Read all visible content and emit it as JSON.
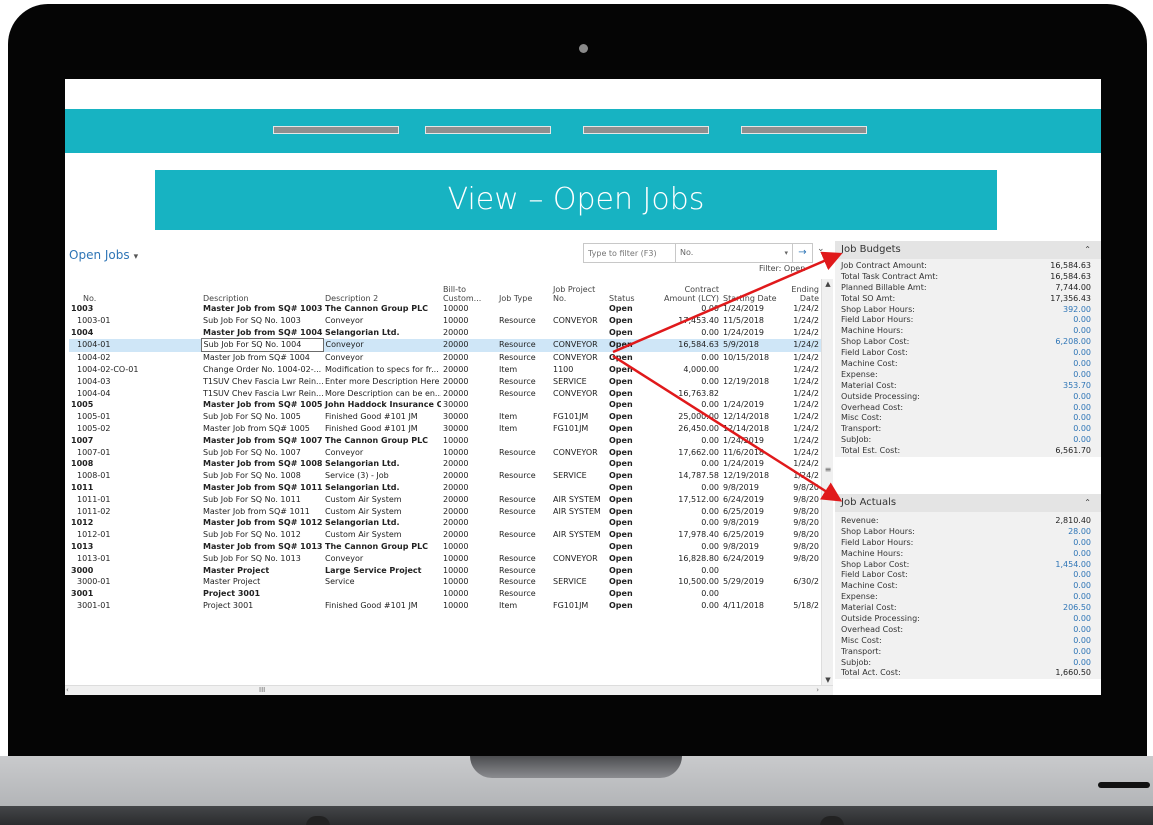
{
  "banner_title": "View – Open Jobs",
  "grid": {
    "title": "Open Jobs",
    "filter_placeholder": "Type to filter (F3)",
    "filter_field": "No.",
    "filter_label": "Filter: Open",
    "columns": [
      "No.",
      "Description",
      "Description 2",
      "Bill-to Custom...",
      "Job Type",
      "Job Project No.",
      "Status",
      "Contract Amount (LCY)",
      "Starting Date",
      "Ending Date"
    ],
    "rows": [
      {
        "no": "1003",
        "desc": "Master Job from SQ# 1003",
        "desc2": "The Cannon Group PLC",
        "bill": "10000",
        "type": "",
        "proj": "",
        "status": "Open",
        "amount": "0.00",
        "start": "1/24/2019",
        "end": "1/24/2",
        "master": true
      },
      {
        "no": "1003-01",
        "desc": "Sub Job For SQ No. 1003",
        "desc2": "Conveyor",
        "bill": "10000",
        "type": "Resource",
        "proj": "CONVEYOR",
        "status": "Open",
        "amount": "17,453.40",
        "start": "11/5/2018",
        "end": "1/24/2",
        "master": false
      },
      {
        "no": "1004",
        "desc": "Master Job from SQ# 1004",
        "desc2": "Selangorian Ltd.",
        "bill": "20000",
        "type": "",
        "proj": "",
        "status": "Open",
        "amount": "0.00",
        "start": "1/24/2019",
        "end": "1/24/2",
        "master": true
      },
      {
        "no": "1004-01",
        "desc": "Sub Job For SQ No. 1004",
        "desc2": "Conveyor",
        "bill": "20000",
        "type": "Resource",
        "proj": "CONVEYOR",
        "status": "Open",
        "amount": "16,584.63",
        "start": "5/9/2018",
        "end": "1/24/2",
        "master": false,
        "selected": true
      },
      {
        "no": "1004-02",
        "desc": "Master Job from SQ# 1004",
        "desc2": "Conveyor",
        "bill": "20000",
        "type": "Resource",
        "proj": "CONVEYOR",
        "status": "Open",
        "amount": "0.00",
        "start": "10/15/2018",
        "end": "1/24/2",
        "master": false
      },
      {
        "no": "1004-02-CO-01",
        "desc": "Change Order No. 1004-02-...",
        "desc2": "Modification to specs for fr...",
        "bill": "20000",
        "type": "Item",
        "proj": "1100",
        "status": "Open",
        "amount": "4,000.00",
        "start": "",
        "end": "1/24/2",
        "master": false
      },
      {
        "no": "1004-03",
        "desc": "T1SUV Chev Fascia Lwr Rein...",
        "desc2": "Enter more Description Here",
        "bill": "20000",
        "type": "Resource",
        "proj": "SERVICE",
        "status": "Open",
        "amount": "0.00",
        "start": "12/19/2018",
        "end": "1/24/2",
        "master": false
      },
      {
        "no": "1004-04",
        "desc": "T1SUV Chev Fascia Lwr Rein...",
        "desc2": "More Description can be en...",
        "bill": "20000",
        "type": "Resource",
        "proj": "CONVEYOR",
        "status": "Open",
        "amount": "16,763.82",
        "start": "",
        "end": "1/24/2",
        "master": false
      },
      {
        "no": "1005",
        "desc": "Master Job from SQ# 1005",
        "desc2": "John Haddock Insurance Co.",
        "bill": "30000",
        "type": "",
        "proj": "",
        "status": "Open",
        "amount": "0.00",
        "start": "1/24/2019",
        "end": "1/24/2",
        "master": true
      },
      {
        "no": "1005-01",
        "desc": "Sub Job For SQ No. 1005",
        "desc2": "Finished Good #101 JM",
        "bill": "30000",
        "type": "Item",
        "proj": "FG101JM",
        "status": "Open",
        "amount": "25,000.00",
        "start": "12/14/2018",
        "end": "1/24/2",
        "master": false
      },
      {
        "no": "1005-02",
        "desc": "Master Job from SQ# 1005",
        "desc2": "Finished Good #101 JM",
        "bill": "30000",
        "type": "Item",
        "proj": "FG101JM",
        "status": "Open",
        "amount": "26,450.00",
        "start": "12/14/2018",
        "end": "1/24/2",
        "master": false
      },
      {
        "no": "1007",
        "desc": "Master Job from SQ# 1007",
        "desc2": "The Cannon Group PLC",
        "bill": "10000",
        "type": "",
        "proj": "",
        "status": "Open",
        "amount": "0.00",
        "start": "1/24/2019",
        "end": "1/24/2",
        "master": true
      },
      {
        "no": "1007-01",
        "desc": "Sub Job For SQ No. 1007",
        "desc2": "Conveyor",
        "bill": "10000",
        "type": "Resource",
        "proj": "CONVEYOR",
        "status": "Open",
        "amount": "17,662.00",
        "start": "11/6/2018",
        "end": "1/24/2",
        "master": false
      },
      {
        "no": "1008",
        "desc": "Master Job from SQ# 1008",
        "desc2": "Selangorian Ltd.",
        "bill": "20000",
        "type": "",
        "proj": "",
        "status": "Open",
        "amount": "0.00",
        "start": "1/24/2019",
        "end": "1/24/2",
        "master": true
      },
      {
        "no": "1008-01",
        "desc": "Sub Job For SQ No. 1008",
        "desc2": "Service (3) - Job",
        "bill": "20000",
        "type": "Resource",
        "proj": "SERVICE",
        "status": "Open",
        "amount": "14,787.58",
        "start": "12/19/2018",
        "end": "1/24/2",
        "master": false
      },
      {
        "no": "1011",
        "desc": "Master Job from SQ# 1011",
        "desc2": "Selangorian Ltd.",
        "bill": "20000",
        "type": "",
        "proj": "",
        "status": "Open",
        "amount": "0.00",
        "start": "9/8/2019",
        "end": "9/8/20",
        "master": true
      },
      {
        "no": "1011-01",
        "desc": "Sub Job For SQ No. 1011",
        "desc2": "Custom Air System",
        "bill": "20000",
        "type": "Resource",
        "proj": "AIR SYSTEM",
        "status": "Open",
        "amount": "17,512.00",
        "start": "6/24/2019",
        "end": "9/8/20",
        "master": false
      },
      {
        "no": "1011-02",
        "desc": "Master Job from SQ# 1011",
        "desc2": "Custom Air System",
        "bill": "20000",
        "type": "Resource",
        "proj": "AIR SYSTEM",
        "status": "Open",
        "amount": "0.00",
        "start": "6/25/2019",
        "end": "9/8/20",
        "master": false
      },
      {
        "no": "1012",
        "desc": "Master Job from SQ# 1012",
        "desc2": "Selangorian Ltd.",
        "bill": "20000",
        "type": "",
        "proj": "",
        "status": "Open",
        "amount": "0.00",
        "start": "9/8/2019",
        "end": "9/8/20",
        "master": true
      },
      {
        "no": "1012-01",
        "desc": "Sub Job For SQ No. 1012",
        "desc2": "Custom Air System",
        "bill": "20000",
        "type": "Resource",
        "proj": "AIR SYSTEM",
        "status": "Open",
        "amount": "17,978.40",
        "start": "6/25/2019",
        "end": "9/8/20",
        "master": false
      },
      {
        "no": "1013",
        "desc": "Master Job from SQ# 1013",
        "desc2": "The Cannon Group PLC",
        "bill": "10000",
        "type": "",
        "proj": "",
        "status": "Open",
        "amount": "0.00",
        "start": "9/8/2019",
        "end": "9/8/20",
        "master": true
      },
      {
        "no": "1013-01",
        "desc": "Sub Job For SQ No. 1013",
        "desc2": "Conveyor",
        "bill": "10000",
        "type": "Resource",
        "proj": "CONVEYOR",
        "status": "Open",
        "amount": "16,828.80",
        "start": "6/24/2019",
        "end": "9/8/20",
        "master": false
      },
      {
        "no": "3000",
        "desc": "Master Project",
        "desc2": "Large Service Project",
        "bill": "10000",
        "type": "Resource",
        "proj": "",
        "status": "Open",
        "amount": "0.00",
        "start": "",
        "end": "",
        "master": true
      },
      {
        "no": "3000-01",
        "desc": "Master Project",
        "desc2": "Service",
        "bill": "10000",
        "type": "Resource",
        "proj": "SERVICE",
        "status": "Open",
        "amount": "10,500.00",
        "start": "5/29/2019",
        "end": "6/30/2",
        "master": false
      },
      {
        "no": "3001",
        "desc": "Project 3001",
        "desc2": "",
        "bill": "10000",
        "type": "Resource",
        "proj": "",
        "status": "Open",
        "amount": "0.00",
        "start": "",
        "end": "",
        "master": true
      },
      {
        "no": "3001-01",
        "desc": "Project 3001",
        "desc2": "Finished Good #101 JM",
        "bill": "10000",
        "type": "Item",
        "proj": "FG101JM",
        "status": "Open",
        "amount": "0.00",
        "start": "4/11/2018",
        "end": "5/18/2",
        "master": false
      }
    ]
  },
  "job_budgets": {
    "title": "Job Budgets",
    "rows": [
      {
        "label": "Job Contract Amount:",
        "value": "16,584.63",
        "link": false
      },
      {
        "label": "Total Task Contract Amt:",
        "value": "16,584.63",
        "link": false
      },
      {
        "label": "Planned Billable Amt:",
        "value": "7,744.00",
        "link": false
      },
      {
        "label": "Total SO Amt:",
        "value": "17,356.43",
        "link": false
      },
      {
        "label": "Shop Labor Hours:",
        "value": "392.00",
        "link": true
      },
      {
        "label": "Field Labor Hours:",
        "value": "0.00",
        "link": true
      },
      {
        "label": "Machine Hours:",
        "value": "0.00",
        "link": true
      },
      {
        "label": "Shop Labor Cost:",
        "value": "6,208.00",
        "link": true
      },
      {
        "label": "Field Labor Cost:",
        "value": "0.00",
        "link": true
      },
      {
        "label": "Machine Cost:",
        "value": "0.00",
        "link": true
      },
      {
        "label": "Expense:",
        "value": "0.00",
        "link": true
      },
      {
        "label": "Material Cost:",
        "value": "353.70",
        "link": true
      },
      {
        "label": "Outside Processing:",
        "value": "0.00",
        "link": true
      },
      {
        "label": "Overhead Cost:",
        "value": "0.00",
        "link": true
      },
      {
        "label": "Misc Cost:",
        "value": "0.00",
        "link": true
      },
      {
        "label": "Transport:",
        "value": "0.00",
        "link": true
      },
      {
        "label": "SubJob:",
        "value": "0.00",
        "link": true
      },
      {
        "label": "Total Est. Cost:",
        "value": "6,561.70",
        "link": false
      }
    ]
  },
  "job_actuals": {
    "title": "Job Actuals",
    "rows": [
      {
        "label": "Revenue:",
        "value": "2,810.40",
        "link": false
      },
      {
        "label": "Shop Labor Hours:",
        "value": "28.00",
        "link": true
      },
      {
        "label": "Field Labor Hours:",
        "value": "0.00",
        "link": true
      },
      {
        "label": "Machine Hours:",
        "value": "0.00",
        "link": true
      },
      {
        "label": "Shop Labor Cost:",
        "value": "1,454.00",
        "link": true
      },
      {
        "label": "Field Labor Cost:",
        "value": "0.00",
        "link": true
      },
      {
        "label": "Machine Cost:",
        "value": "0.00",
        "link": true
      },
      {
        "label": "Expense:",
        "value": "0.00",
        "link": true
      },
      {
        "label": "Material Cost:",
        "value": "206.50",
        "link": true
      },
      {
        "label": "Outside Processing:",
        "value": "0.00",
        "link": true
      },
      {
        "label": "Overhead Cost:",
        "value": "0.00",
        "link": true
      },
      {
        "label": "Misc Cost:",
        "value": "0.00",
        "link": true
      },
      {
        "label": "Transport:",
        "value": "0.00",
        "link": true
      },
      {
        "label": "Subjob:",
        "value": "0.00",
        "link": true
      },
      {
        "label": "Total Act. Cost:",
        "value": "1,660.50",
        "link": false
      }
    ]
  },
  "icons": {
    "scroll_up": "▲",
    "scroll_down": "▼",
    "scroll_thumb": "≡",
    "scroll_left": "‹",
    "scroll_right": "›",
    "scroll_h_thumb": "III",
    "collapse": "⌃",
    "expand": "⌄",
    "go": "→",
    "dropdown": "▾",
    "caret": "▾"
  },
  "colors": {
    "accent": "#17b3c2",
    "link": "#2e75b6",
    "arrow": "#e0191b",
    "selected_row": "#cfe6f7"
  }
}
